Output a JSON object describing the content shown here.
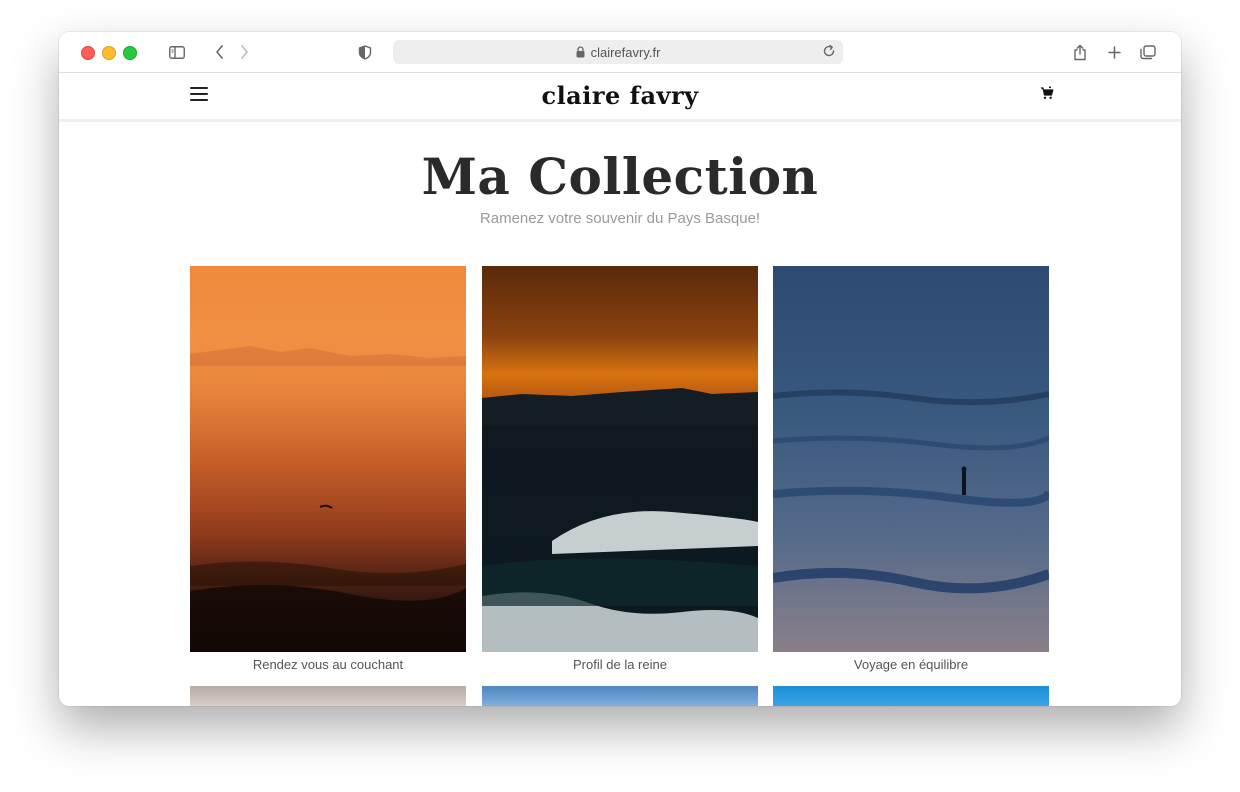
{
  "browser": {
    "url": "clairefavry.fr"
  },
  "site": {
    "brand": "claire favry"
  },
  "main": {
    "title": "Ma Collection",
    "subtitle": "Ramenez votre souvenir du Pays Basque!"
  },
  "collection": [
    {
      "caption": "Rendez vous au couchant"
    },
    {
      "caption": "Profil de la reine"
    },
    {
      "caption": "Voyage en équilibre"
    }
  ],
  "icons": {
    "sidebar": "sidebar-icon",
    "back": "chevron-left-icon",
    "forward": "chevron-right-icon",
    "privacy": "shield-icon",
    "lock": "lock-icon",
    "reload": "reload-icon",
    "share": "share-icon",
    "new_tab": "plus-icon",
    "tabs": "tabs-overview-icon",
    "menu": "hamburger-icon",
    "cart": "cart-icon"
  },
  "colors": {
    "traffic_red": "#ff5f57",
    "traffic_yellow": "#febc2e",
    "traffic_green": "#28c840",
    "title": "#2a2a2a",
    "subtitle": "#9a9a9a"
  }
}
